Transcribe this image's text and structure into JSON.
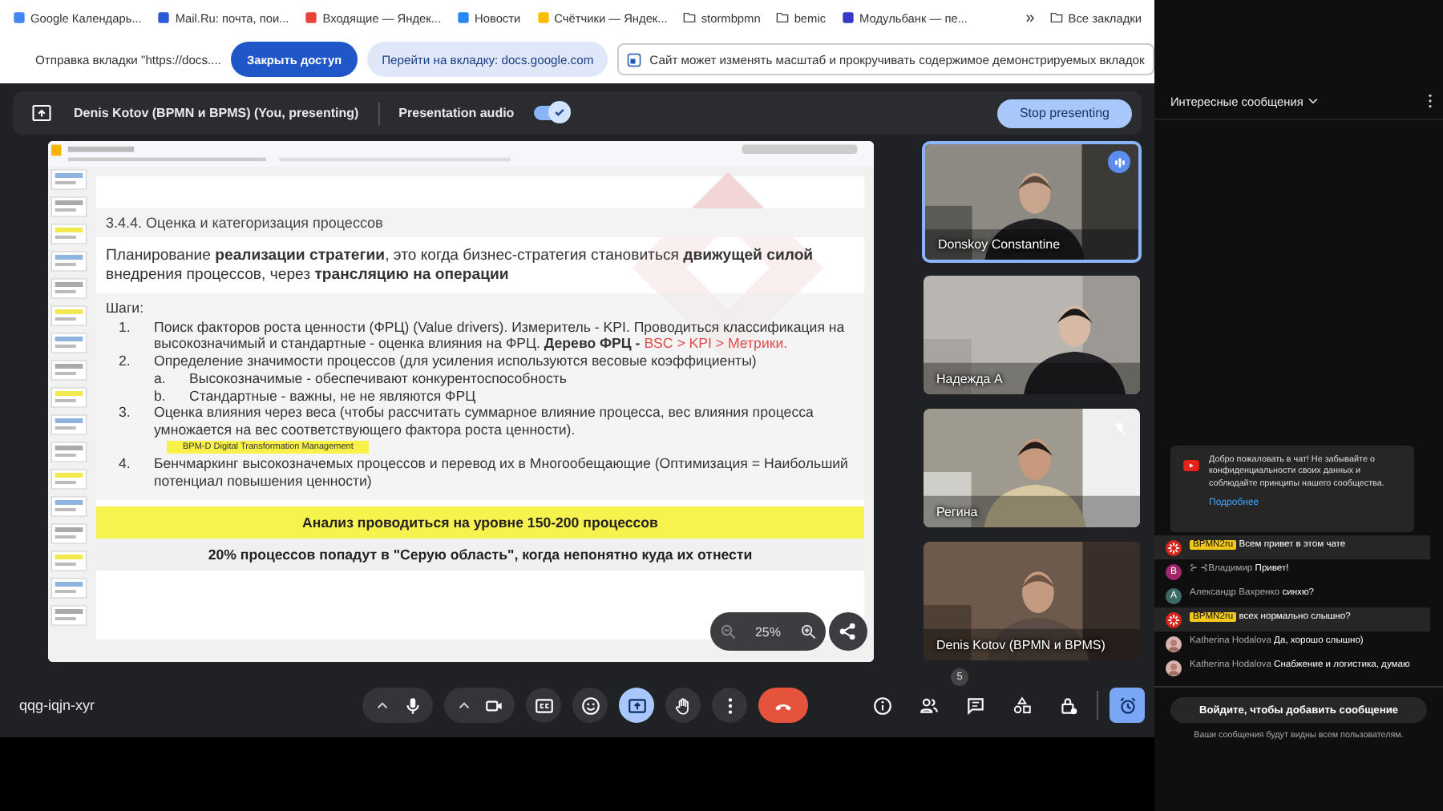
{
  "bookmarks": [
    {
      "label": "Google Календарь...",
      "kind": "calendar"
    },
    {
      "label": "Mail.Ru: почта, пои...",
      "kind": "mail"
    },
    {
      "label": "Входящие — Яндек...",
      "kind": "inbox"
    },
    {
      "label": "Новости",
      "kind": "vk"
    },
    {
      "label": "Счётчики — Яндек...",
      "kind": "metrics"
    },
    {
      "label": "stormbpmn",
      "kind": "folder"
    },
    {
      "label": "bemic",
      "kind": "folder"
    },
    {
      "label": "Модульбанк — пе...",
      "kind": "bank"
    }
  ],
  "bookmarks_more": "»",
  "all_bookmarks": "Все закладки",
  "share_bar": {
    "text": "Отправка вкладки \"https://docs....",
    "stop_button": "Закрыть доступ",
    "switch_button": "Перейти на вкладку: docs.google.com",
    "notice": "Сайт может изменять масштаб и прокручивать содержимое демонстрируемых вкладок"
  },
  "presenting": {
    "name": "Denis Kotov (BPMN и BPMS) (You, presenting)",
    "audio_label": "Presentation audio",
    "audio_on": true,
    "stop_button": "Stop presenting"
  },
  "slide": {
    "heading": "3.4.4. Оценка и категоризация процессов",
    "intro": "Планирование **реализации стратегии**, это когда бизнес-стратегия становиться **движущей силой** внедрения процессов, через **трансляцию на операции**",
    "steps_label": "Шаги:",
    "steps": [
      {
        "marker": "1.",
        "text": "Поиск факторов роста ценности (ФРЦ) (Value drivers). Измеритель - KPI. Проводиться классификация на высокозначимый и стандартные - оценка влияния на ФРЦ. **Дерево ФРЦ -** ",
        "red_text": "BSC > KPI > Метрики."
      },
      {
        "marker": "2.",
        "text": "Определение значимости процессов (для усиления используются весовые коэффициенты)",
        "children": [
          {
            "marker": "a.",
            "text": "Высокозначимые - обеспечивают конкурентоспособность"
          },
          {
            "marker": "b.",
            "text": "Стандартные - важны, не не являются ФРЦ"
          }
        ]
      },
      {
        "marker": "3.",
        "text": "Оценка влияния через веса (чтобы рассчитать суммарное влияние процесса, вес влияния процесса умножается на вес соответствующего фактора роста ценности).",
        "note": "BPM-D Digital Transformation Management"
      },
      {
        "marker": "4.",
        "text": "Бенчмаркинг высокозначемых процессов и перевод их в Многообещающие (Оптимизация = Наибольший потенциал повышения ценности)"
      }
    ],
    "yellow_banner": "Анализ проводиться на уровне 150-200 процессов",
    "gray_banner": "20% процессов попадут в \"Серую область\", когда непонятно куда их отнести",
    "zoom": "25%"
  },
  "tiles": [
    {
      "name": "Donskoy Constantine",
      "speaking": true,
      "muted": false
    },
    {
      "name": "Надежда А",
      "speaking": false,
      "muted": false
    },
    {
      "name": "Регина",
      "speaking": false,
      "muted": true
    },
    {
      "name": "Denis Kotov (BPMN и BPMS)",
      "speaking": false,
      "muted": false
    }
  ],
  "meeting_code": "qqg-iqjn-xyr",
  "controls": [
    {
      "kind": "mic",
      "on": false
    },
    {
      "kind": "camera",
      "on": false
    },
    {
      "kind": "captions",
      "on": false
    },
    {
      "kind": "emoji",
      "on": false
    },
    {
      "kind": "present",
      "on": true
    },
    {
      "kind": "hand",
      "on": false
    },
    {
      "kind": "more",
      "on": false
    },
    {
      "kind": "end",
      "on": false
    }
  ],
  "side_tools": [
    {
      "kind": "info",
      "on": false
    },
    {
      "kind": "people",
      "on": false,
      "badge": "5"
    },
    {
      "kind": "chat",
      "on": false
    },
    {
      "kind": "activities",
      "on": false
    },
    {
      "kind": "lock",
      "on": false
    },
    {
      "kind": "alarm",
      "on": true
    }
  ],
  "chat": {
    "title": "Интересные сообщения",
    "welcome": "Добро пожаловать в чат! Не забывайте о конфиденциальности своих данных и соблюдайте принципы нашего сообщества.",
    "welcome_link": "Подробнее",
    "messages": [
      {
        "author": "BPMN2ru",
        "text": "Всем привет в этом чате",
        "kind": "logo",
        "owner": true,
        "highlighted": true
      },
      {
        "author": "⊱ ⊰Владимир",
        "text": "Привет!",
        "kind": "letter",
        "letter": "B",
        "color": "#a0286a",
        "owner": false,
        "highlighted": false
      },
      {
        "author": "Александр Вахренко",
        "text": "синхю?",
        "kind": "letter",
        "letter": "A",
        "color": "#3f6b66",
        "owner": false,
        "highlighted": false
      },
      {
        "author": "BPMN2ru",
        "text": "всех нормально слышно?",
        "kind": "logo",
        "owner": true,
        "highlighted": true
      },
      {
        "author": "Katherina Hodalova",
        "text": "Да, хорошо слышно)",
        "owner": false,
        "highlighted": false
      },
      {
        "author": "Katherina Hodalova",
        "text": "Снабжение и логистика, думаю",
        "owner": false,
        "highlighted": false
      }
    ],
    "login_button": "Войдите, чтобы добавить сообщение",
    "footer": "Ваши сообщения будут видны всем пользователям."
  }
}
